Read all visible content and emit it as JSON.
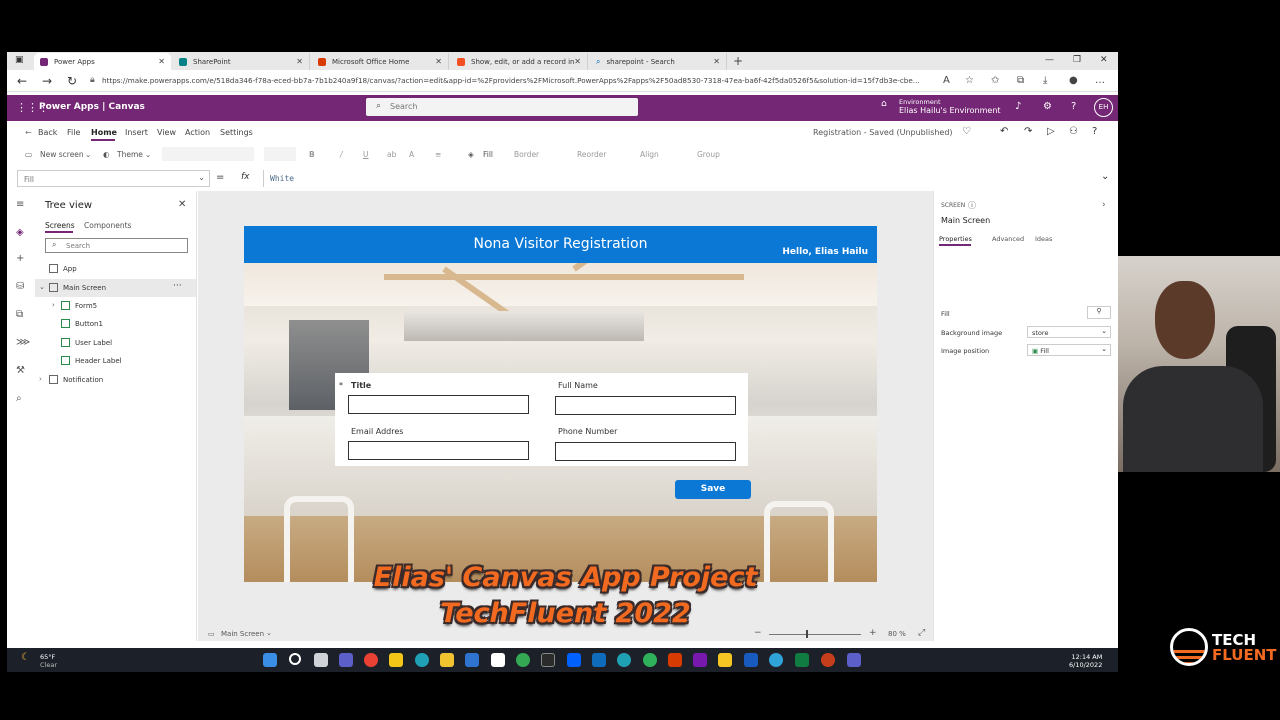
{
  "browser": {
    "tabs": [
      {
        "label": "Power Apps",
        "color": "#742774"
      },
      {
        "label": "SharePoint",
        "color": "#038387"
      },
      {
        "label": "Microsoft Office Home",
        "color": "#d83b01"
      },
      {
        "label": "Show, edit, or add a record in a",
        "color": "#f25022"
      },
      {
        "label": "sharepoint - Search",
        "color": "#0067b8"
      }
    ],
    "url": "https://make.powerapps.com/e/518da346-f78a-eced-bb7a-7b1b240a9f18/canvas/?action=edit&app-id=%2Fproviders%2FMicrosoft.PowerApps%2Fapps%2F50ad8530-7318-47ea-ba6f-42f5da0526f5&solution-id=15f7db3e-cbe..."
  },
  "powerapps": {
    "brand": "Power Apps  |  Canvas",
    "search_placeholder": "Search",
    "environment_label": "Environment",
    "environment_name": "Elias Hailu's Environment",
    "avatar_initials": "EH"
  },
  "menu": {
    "back": "Back",
    "items": [
      "File",
      "Home",
      "Insert",
      "View",
      "Action",
      "Settings"
    ],
    "status": "Registration - Saved (Unpublished)"
  },
  "commandbar": {
    "new_screen": "New screen",
    "theme": "Theme",
    "fill": "Fill",
    "border": "Border",
    "reorder": "Reorder",
    "align": "Align",
    "group": "Group"
  },
  "formula": {
    "property": "Fill",
    "fx": "fx",
    "value": "White"
  },
  "tree": {
    "title": "Tree view",
    "tabs": [
      "Screens",
      "Components"
    ],
    "search_placeholder": "Search",
    "items": {
      "app": "App",
      "main_screen": "Main Screen",
      "form5": "Form5",
      "button1": "Button1",
      "user_label": "User Label",
      "header_label": "Header Label",
      "notification": "Notification"
    }
  },
  "app": {
    "header_title": "Nona Visitor Registration",
    "greeting": "Hello, Elias Hailu",
    "fields": [
      {
        "label": "Title",
        "required": true,
        "value": ""
      },
      {
        "label": "Full Name",
        "required": false,
        "value": ""
      },
      {
        "label": "Email Addres",
        "required": false,
        "value": ""
      },
      {
        "label": "Phone Number",
        "required": false,
        "value": ""
      }
    ],
    "save_label": "Save",
    "accent": "#0c78d6"
  },
  "overlay": {
    "line1": "Elias' Canvas App Project",
    "line2": "TechFluent 2022"
  },
  "canvas_footer": {
    "screen": "Main Screen",
    "zoom": "80 %"
  },
  "properties": {
    "kind": "SCREEN",
    "name": "Main Screen",
    "tabs": [
      "Properties",
      "Advanced",
      "Ideas"
    ],
    "fill_label": "Fill",
    "background_image_label": "Background image",
    "background_image_value": "store",
    "image_position_label": "Image position",
    "image_position_value": "Fill"
  },
  "taskbar": {
    "temp": "65°F",
    "condition": "Clear",
    "time": "12:14 AM",
    "date": "6/10/2022"
  },
  "logo": {
    "line1": "TECH",
    "line2": "FLUENT"
  }
}
